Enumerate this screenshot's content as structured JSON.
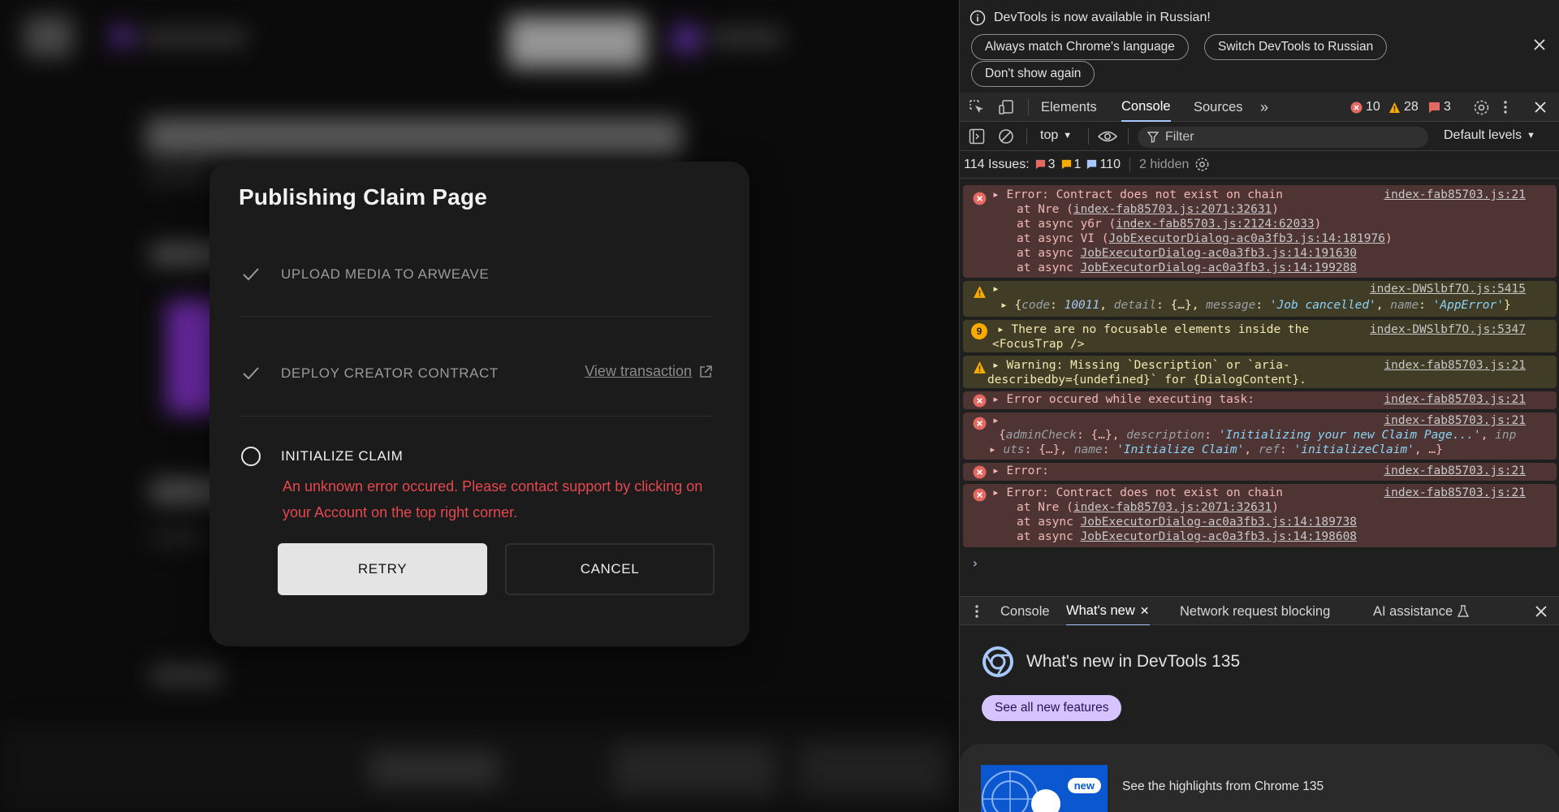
{
  "modal": {
    "title": "Publishing Claim Page",
    "steps": [
      {
        "label": "UPLOAD MEDIA TO ARWEAVE",
        "status": "done"
      },
      {
        "label": "DEPLOY CREATOR CONTRACT",
        "status": "done",
        "link": "View transaction"
      },
      {
        "label": "INITIALIZE CLAIM",
        "status": "pending"
      }
    ],
    "error": "An unknown error occured. Please contact support by clicking on your Account on the top right corner.",
    "retry_label": "RETRY",
    "cancel_label": "CANCEL"
  },
  "devtools": {
    "notice": {
      "message": "DevTools is now available in Russian!",
      "btn_match": "Always match Chrome's language",
      "btn_switch": "Switch DevTools to Russian",
      "btn_dismiss": "Don't show again"
    },
    "tabs": [
      "Elements",
      "Console",
      "Sources"
    ],
    "counts": {
      "errors": "10",
      "warnings": "28",
      "issues_flag": "3"
    },
    "context": "top",
    "filter_placeholder": "Filter",
    "levels": "Default levels",
    "issues": {
      "label": "114 Issues:",
      "err": "3",
      "warn": "1",
      "info": "110",
      "hidden": "2 hidden"
    },
    "log": {
      "r1": {
        "l1": "Error: Contract does not exist on chain",
        "src": "index-fab85703.js:21",
        "l2a": "at Nre (",
        "l2b": "index-fab85703.js:2071:32631",
        "l2c": ")",
        "l3a": "at async y6r (",
        "l3b": "index-fab85703.js:2124:62033",
        "l3c": ")",
        "l4a": "at async VI (",
        "l4b": "JobExecutorDialog-ac0a3fb3.js:14:181976",
        "l4c": ")",
        "l5a": "at async ",
        "l5b": "JobExecutorDialog-ac0a3fb3.js:14:191630",
        "l6a": "at async ",
        "l6b": "JobExecutorDialog-ac0a3fb3.js:14:199288"
      },
      "r2": {
        "src": "index-DWSlbf7O.js:5415",
        "k1": "code",
        "v1": "10011",
        "k2": "detail",
        "v2": "{…}",
        "k3": "message",
        "v3": "'Job cancelled'",
        "k4": "name",
        "v4": "'AppError'"
      },
      "r3": {
        "count": "9",
        "l1": "There are no focusable elements inside the",
        "l2": "<FocusTrap />",
        "src": "index-DWSlbf7O.js:5347"
      },
      "r4": {
        "l1": "Warning: Missing `Description` or `aria-",
        "l2": "describedby={undefined}` for {DialogContent}.",
        "src": "index-fab85703.js:21"
      },
      "r5": {
        "l1": "Error occured while executing task:",
        "src": "index-fab85703.js:21"
      },
      "r6": {
        "src": "index-fab85703.js:21",
        "k1": "adminCheck",
        "v1": "{…}",
        "k2": "description",
        "v2": "'Initializing your new Claim Page...'",
        "k3tail": "inp",
        "k3": "uts",
        "v3": "{…}",
        "k4": "name",
        "v4": "'Initialize Claim'",
        "k5": "ref",
        "v5": "'initializeClaim'"
      },
      "r7": {
        "l1": "Error:",
        "src": "index-fab85703.js:21"
      },
      "r8": {
        "l1": "Error: Contract does not exist on chain",
        "src": "index-fab85703.js:21",
        "l2a": "at Nre (",
        "l2b": "index-fab85703.js:2071:32631",
        "l2c": ")",
        "l3a": "at async ",
        "l3b": "JobExecutorDialog-ac0a3fb3.js:14:189738",
        "l4a": "at async ",
        "l4b": "JobExecutorDialog-ac0a3fb3.js:14:198608"
      }
    },
    "drawer_tabs": [
      "Console",
      "What's new",
      "Network request blocking",
      "AI assistance"
    ],
    "whatsnew": {
      "title": "What's new in DevTools 135",
      "features_btn": "See all new features",
      "new_tag": "new",
      "highlight": "See the highlights from Chrome 135"
    }
  },
  "colors": {
    "error": "#e5474f",
    "modal_bg": "#1b1b1b",
    "devtools_bg": "#1f1f1f",
    "link_blue": "#a8c7fa"
  }
}
